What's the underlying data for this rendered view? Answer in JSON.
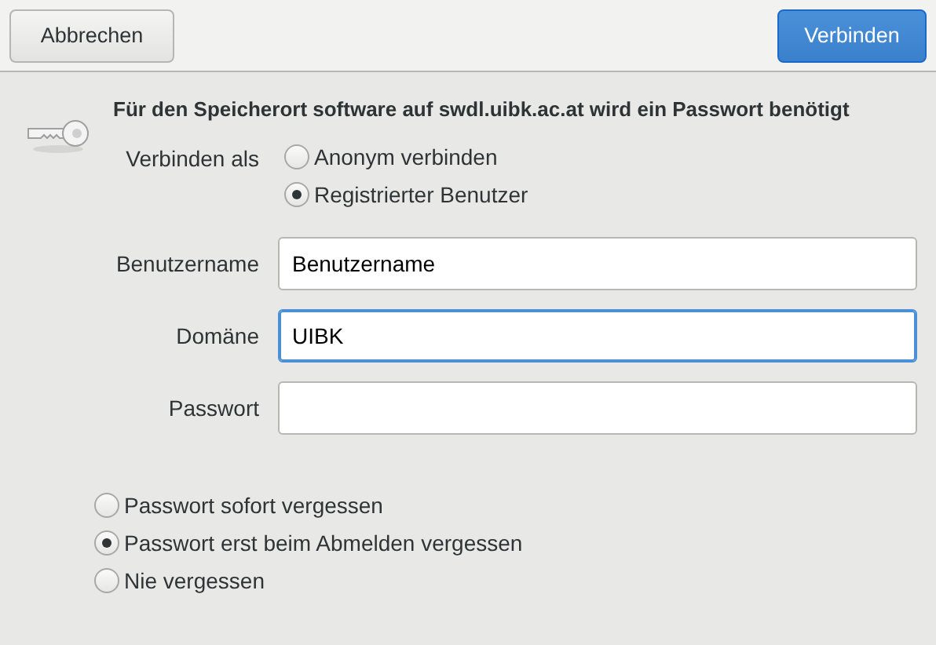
{
  "header": {
    "cancel": "Abbrechen",
    "confirm": "Verbinden"
  },
  "message": "Für den Speicherort software auf swdl.uibk.ac.at wird ein Passwort benötigt",
  "connect_as": {
    "label": "Verbinden als",
    "options": [
      {
        "label": "Anonym verbinden",
        "selected": false
      },
      {
        "label": "Registrierter Benutzer",
        "selected": true
      }
    ]
  },
  "fields": [
    {
      "label": "Benutzername",
      "value": "Benutzername",
      "focused": false
    },
    {
      "label": "Domäne",
      "value": "UIBK",
      "focused": true
    },
    {
      "label": "Passwort",
      "focused": false
    }
  ],
  "remember": [
    {
      "label": "Passwort sofort vergessen",
      "selected": false
    },
    {
      "label": "Passwort erst beim Abmelden vergessen",
      "selected": true
    },
    {
      "label": "Nie vergessen",
      "selected": false
    }
  ]
}
